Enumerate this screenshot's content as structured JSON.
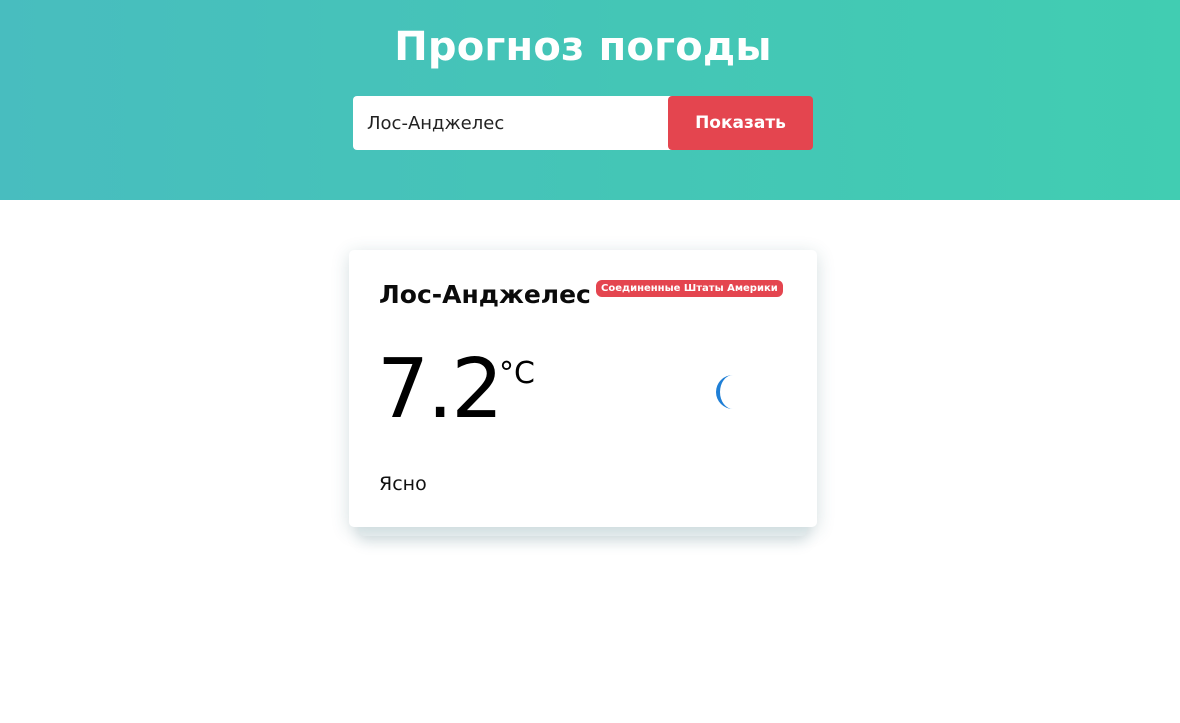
{
  "header": {
    "title": "Прогноз погоды",
    "search": {
      "value": "Лос-Анджелес",
      "placeholder": ""
    },
    "submit_label": "Показать"
  },
  "weather_card": {
    "city": "Лос-Анджелес",
    "country": "Соединенные Штаты Америки",
    "temperature": "7.2",
    "unit": "°C",
    "description": "Ясно",
    "icon": "moon-icon"
  },
  "colors": {
    "accent": "#e4454f",
    "header_gradient_start": "#48bdbf",
    "header_gradient_end": "#41cdb2",
    "icon_blue": "#1f7fd6"
  }
}
